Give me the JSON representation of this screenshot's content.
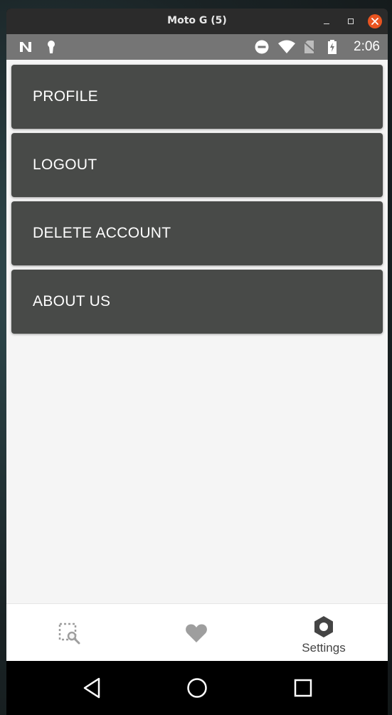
{
  "window": {
    "title": "Moto G (5)"
  },
  "status_bar": {
    "time": "2:06",
    "icons": [
      "n-notification-icon",
      "keyhole-icon",
      "do-not-disturb-icon",
      "wifi-icon",
      "no-sim-icon",
      "battery-charging-icon"
    ]
  },
  "menu": {
    "items": [
      {
        "label": "PROFILE"
      },
      {
        "label": "LOGOUT"
      },
      {
        "label": "DELETE ACCOUNT"
      },
      {
        "label": "ABOUT US"
      }
    ]
  },
  "bottom_nav": {
    "items": [
      {
        "icon": "search-selection-icon",
        "label": ""
      },
      {
        "icon": "heart-icon",
        "label": ""
      },
      {
        "icon": "settings-hexagon-icon",
        "label": "Settings",
        "active": true
      }
    ]
  },
  "colors": {
    "menu_button": "#484a48",
    "status_bar": "#757575",
    "background": "#f5f5f5",
    "close_button": "#e95420"
  }
}
